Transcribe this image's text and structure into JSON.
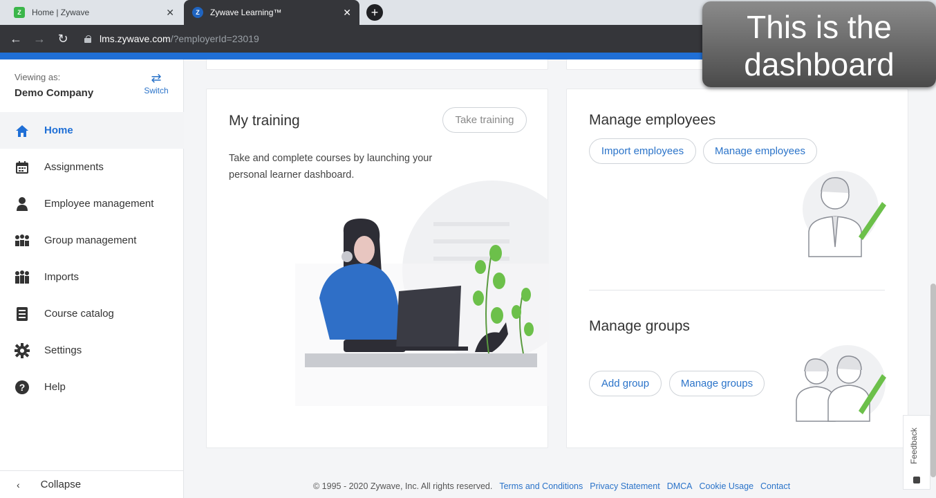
{
  "browser": {
    "tabs": [
      {
        "label": "Home | Zywave",
        "favicon": "Z",
        "active": false
      },
      {
        "label": "Zywave Learning™",
        "favicon": "Z",
        "active": true
      }
    ],
    "url_host": "lms.zywave.com",
    "url_path": "/?employerId=23019"
  },
  "overlay": {
    "line1": "This is the",
    "line2": "dashboard"
  },
  "sidebar": {
    "viewing_label": "Viewing as:",
    "company": "Demo Company",
    "switch_label": "Switch",
    "items": [
      {
        "label": "Home",
        "icon": "home-icon",
        "active": true
      },
      {
        "label": "Assignments",
        "icon": "calendar-icon",
        "active": false
      },
      {
        "label": "Employee management",
        "icon": "person-icon",
        "active": false
      },
      {
        "label": "Group management",
        "icon": "group-icon",
        "active": false
      },
      {
        "label": "Imports",
        "icon": "imports-icon",
        "active": false
      },
      {
        "label": "Course catalog",
        "icon": "catalog-icon",
        "active": false
      },
      {
        "label": "Settings",
        "icon": "gear-icon",
        "active": false
      },
      {
        "label": "Help",
        "icon": "help-icon",
        "active": false
      }
    ],
    "collapse_label": "Collapse"
  },
  "training": {
    "title": "My training",
    "take_training": "Take training",
    "description": "Take and complete courses by launching your personal learner dashboard."
  },
  "employees": {
    "title": "Manage employees",
    "import_label": "Import employees",
    "manage_label": "Manage employees"
  },
  "groups": {
    "title": "Manage groups",
    "add_label": "Add group",
    "manage_label": "Manage groups"
  },
  "footer": {
    "copyright": "© 1995 - 2020 Zywave, Inc. All rights reserved.",
    "links": [
      "Terms and Conditions",
      "Privacy Statement",
      "DMCA",
      "Cookie Usage",
      "Contact"
    ]
  },
  "feedback_label": "Feedback",
  "colors": {
    "accent": "#1f6fd6",
    "link": "#2a73c9",
    "plant": "#6cc04a"
  }
}
